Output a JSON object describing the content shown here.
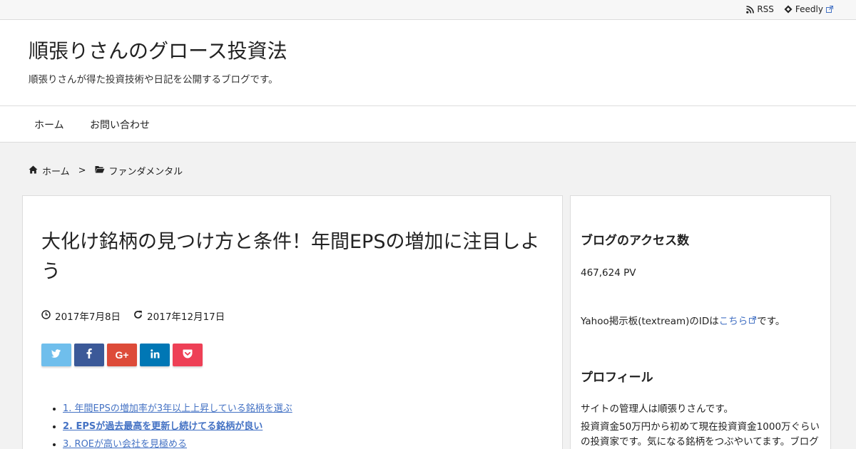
{
  "topbar": {
    "rss_label": "RSS",
    "feedly_label": "Feedly"
  },
  "header": {
    "site_title": "順張りさんのグロース投資法",
    "site_description": "順張りさんが得た投資技術や日記を公開するブログです。"
  },
  "nav": {
    "items": [
      {
        "label": "ホーム"
      },
      {
        "label": "お問い合わせ"
      }
    ]
  },
  "breadcrumb": {
    "home": "ホーム",
    "separator": ">",
    "category": "ファンダメンタル"
  },
  "article": {
    "title": "大化け銘柄の見つけ方と条件！年間EPSの増加に注目しよう",
    "published": "2017年7月8日",
    "updated": "2017年12月17日",
    "share_buttons": [
      {
        "icon": "twitter-icon",
        "color": "#6fbeec"
      },
      {
        "icon": "facebook-icon",
        "color": "#3b5998"
      },
      {
        "icon": "google-plus-icon",
        "color": "#dd4b39",
        "label": "G+"
      },
      {
        "icon": "linkedin-icon",
        "color": "#0077b5"
      },
      {
        "icon": "pocket-icon",
        "color": "#ee4056"
      }
    ],
    "toc": [
      "1. 年間EPSの増加率が3年以上上昇している銘柄を選ぶ",
      "2. EPSが過去最高を更新し続けてる銘柄が良い",
      "3. ROEが高い会社を見極める"
    ]
  },
  "sidebar": {
    "access_title": "ブログのアクセス数",
    "access_count": "467,624 PV",
    "yahoo_text_before": "Yahoo掲示板(textream)のIDは",
    "yahoo_link": "こちら",
    "yahoo_text_after": "です。",
    "profile_title": "プロフィール",
    "profile_line1": "サイトの管理人は順張りさんです。",
    "profile_line2": "投資資金50万円から初めて現在投資資金1000万ぐらいの投資家です。気になる銘柄をつぶやいてます。ブログは土曜か日曜の時間がある時に更新します。"
  }
}
